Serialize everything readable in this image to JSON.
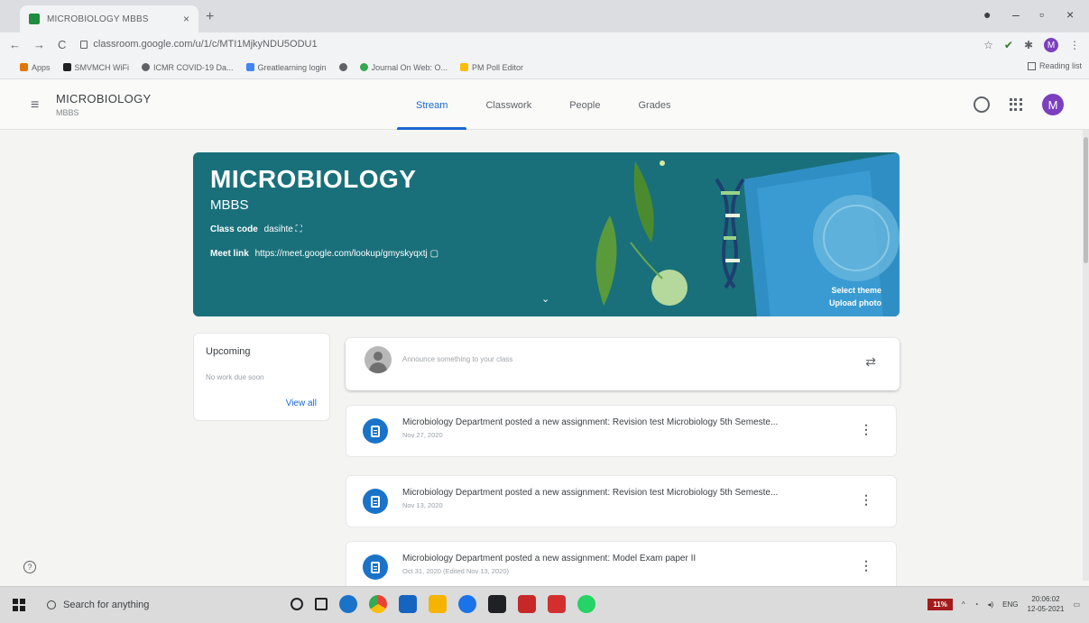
{
  "browser": {
    "tab_title": "MICROBIOLOGY MBBS",
    "url": "classroom.google.com/u/1/c/MTI1MjkyNDU5ODU1",
    "profile_initial": "M",
    "bookmarks": [
      "Apps",
      "SMVMCH WiFi",
      "ICMR COVID-19 Da...",
      "Greatlearning login",
      "Journal On Web: O...",
      "PM Poll Editor"
    ],
    "reading_list": "Reading list"
  },
  "header": {
    "class_name": "MICROBIOLOGY",
    "section": "MBBS",
    "tabs": [
      {
        "label": "Stream",
        "active": true
      },
      {
        "label": "Classwork",
        "active": false
      },
      {
        "label": "People",
        "active": false
      },
      {
        "label": "Grades",
        "active": false
      }
    ],
    "avatar_initial": "M"
  },
  "banner": {
    "title": "MICROBIOLOGY",
    "subtitle": "MBBS",
    "class_code_label": "Class code",
    "class_code": "dasihte",
    "meet_label": "Meet link",
    "meet_url": "https://meet.google.com/lookup/gmyskyqxtj",
    "select_theme": "Select theme",
    "upload_photo": "Upload photo",
    "color": "#19707a"
  },
  "upcoming": {
    "title": "Upcoming",
    "empty": "No work due soon",
    "view_all": "View all"
  },
  "announce": {
    "placeholder": "Announce something to your class"
  },
  "posts": [
    {
      "text": "Microbiology Department posted a new assignment: Revision test Microbiology 5th Semeste...",
      "date": "Nov 27, 2020"
    },
    {
      "text": "Microbiology Department posted a new assignment: Revision test Microbiology 5th Semeste...",
      "date": "Nov 13, 2020"
    },
    {
      "text": "Microbiology Department posted a new assignment: Model Exam paper II",
      "date": "Oct 31, 2020 (Edited Nov 13, 2020)"
    }
  ],
  "taskbar": {
    "search_placeholder": "Search for anything",
    "battery": "11%",
    "language": "ENG",
    "time": "20:06:02",
    "date": "12-05-2021"
  }
}
